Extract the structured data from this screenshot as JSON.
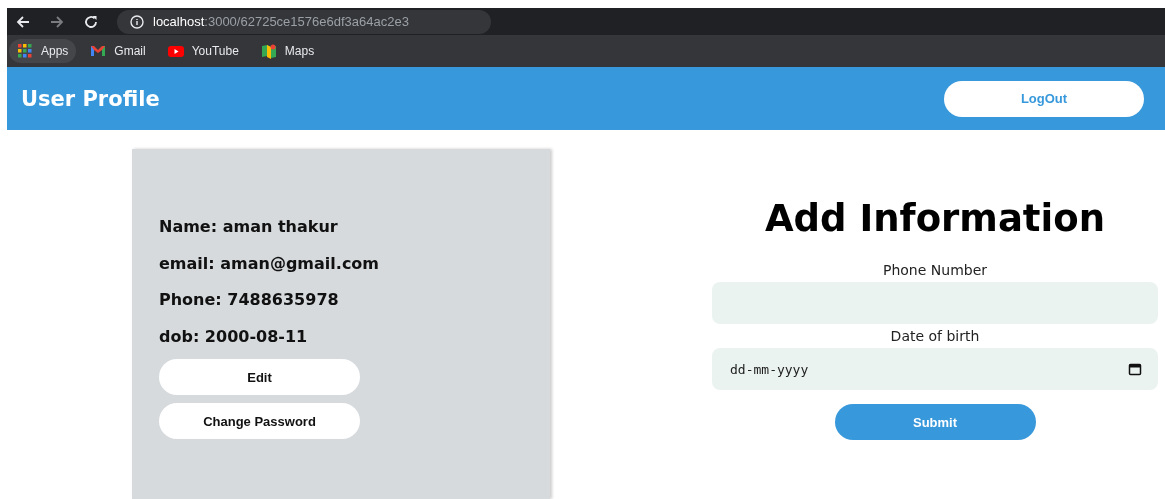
{
  "browser": {
    "url_host": "localhost",
    "url_path": ":3000/62725ce1576e6df3a64ac2e3",
    "bookmarks": [
      {
        "label": "Apps",
        "kind": "apps"
      },
      {
        "label": "Gmail",
        "kind": "gmail"
      },
      {
        "label": "YouTube",
        "kind": "youtube"
      },
      {
        "label": "Maps",
        "kind": "maps"
      }
    ]
  },
  "header": {
    "title": "User Profile",
    "logout": "LogOut"
  },
  "profile": {
    "lines": [
      "Name: aman thakur",
      "email: aman@gmail.com",
      "Phone: 7488635978",
      "dob: 2000-08-11"
    ],
    "buttons": [
      "Edit",
      "Change Password"
    ]
  },
  "form": {
    "heading": "Add Information",
    "fields": [
      {
        "label": "Phone Number",
        "kind": "text"
      },
      {
        "label": "Date of birth",
        "kind": "date",
        "placeholder": "dd-mm-yyyy"
      }
    ],
    "submit": "Submit"
  }
}
